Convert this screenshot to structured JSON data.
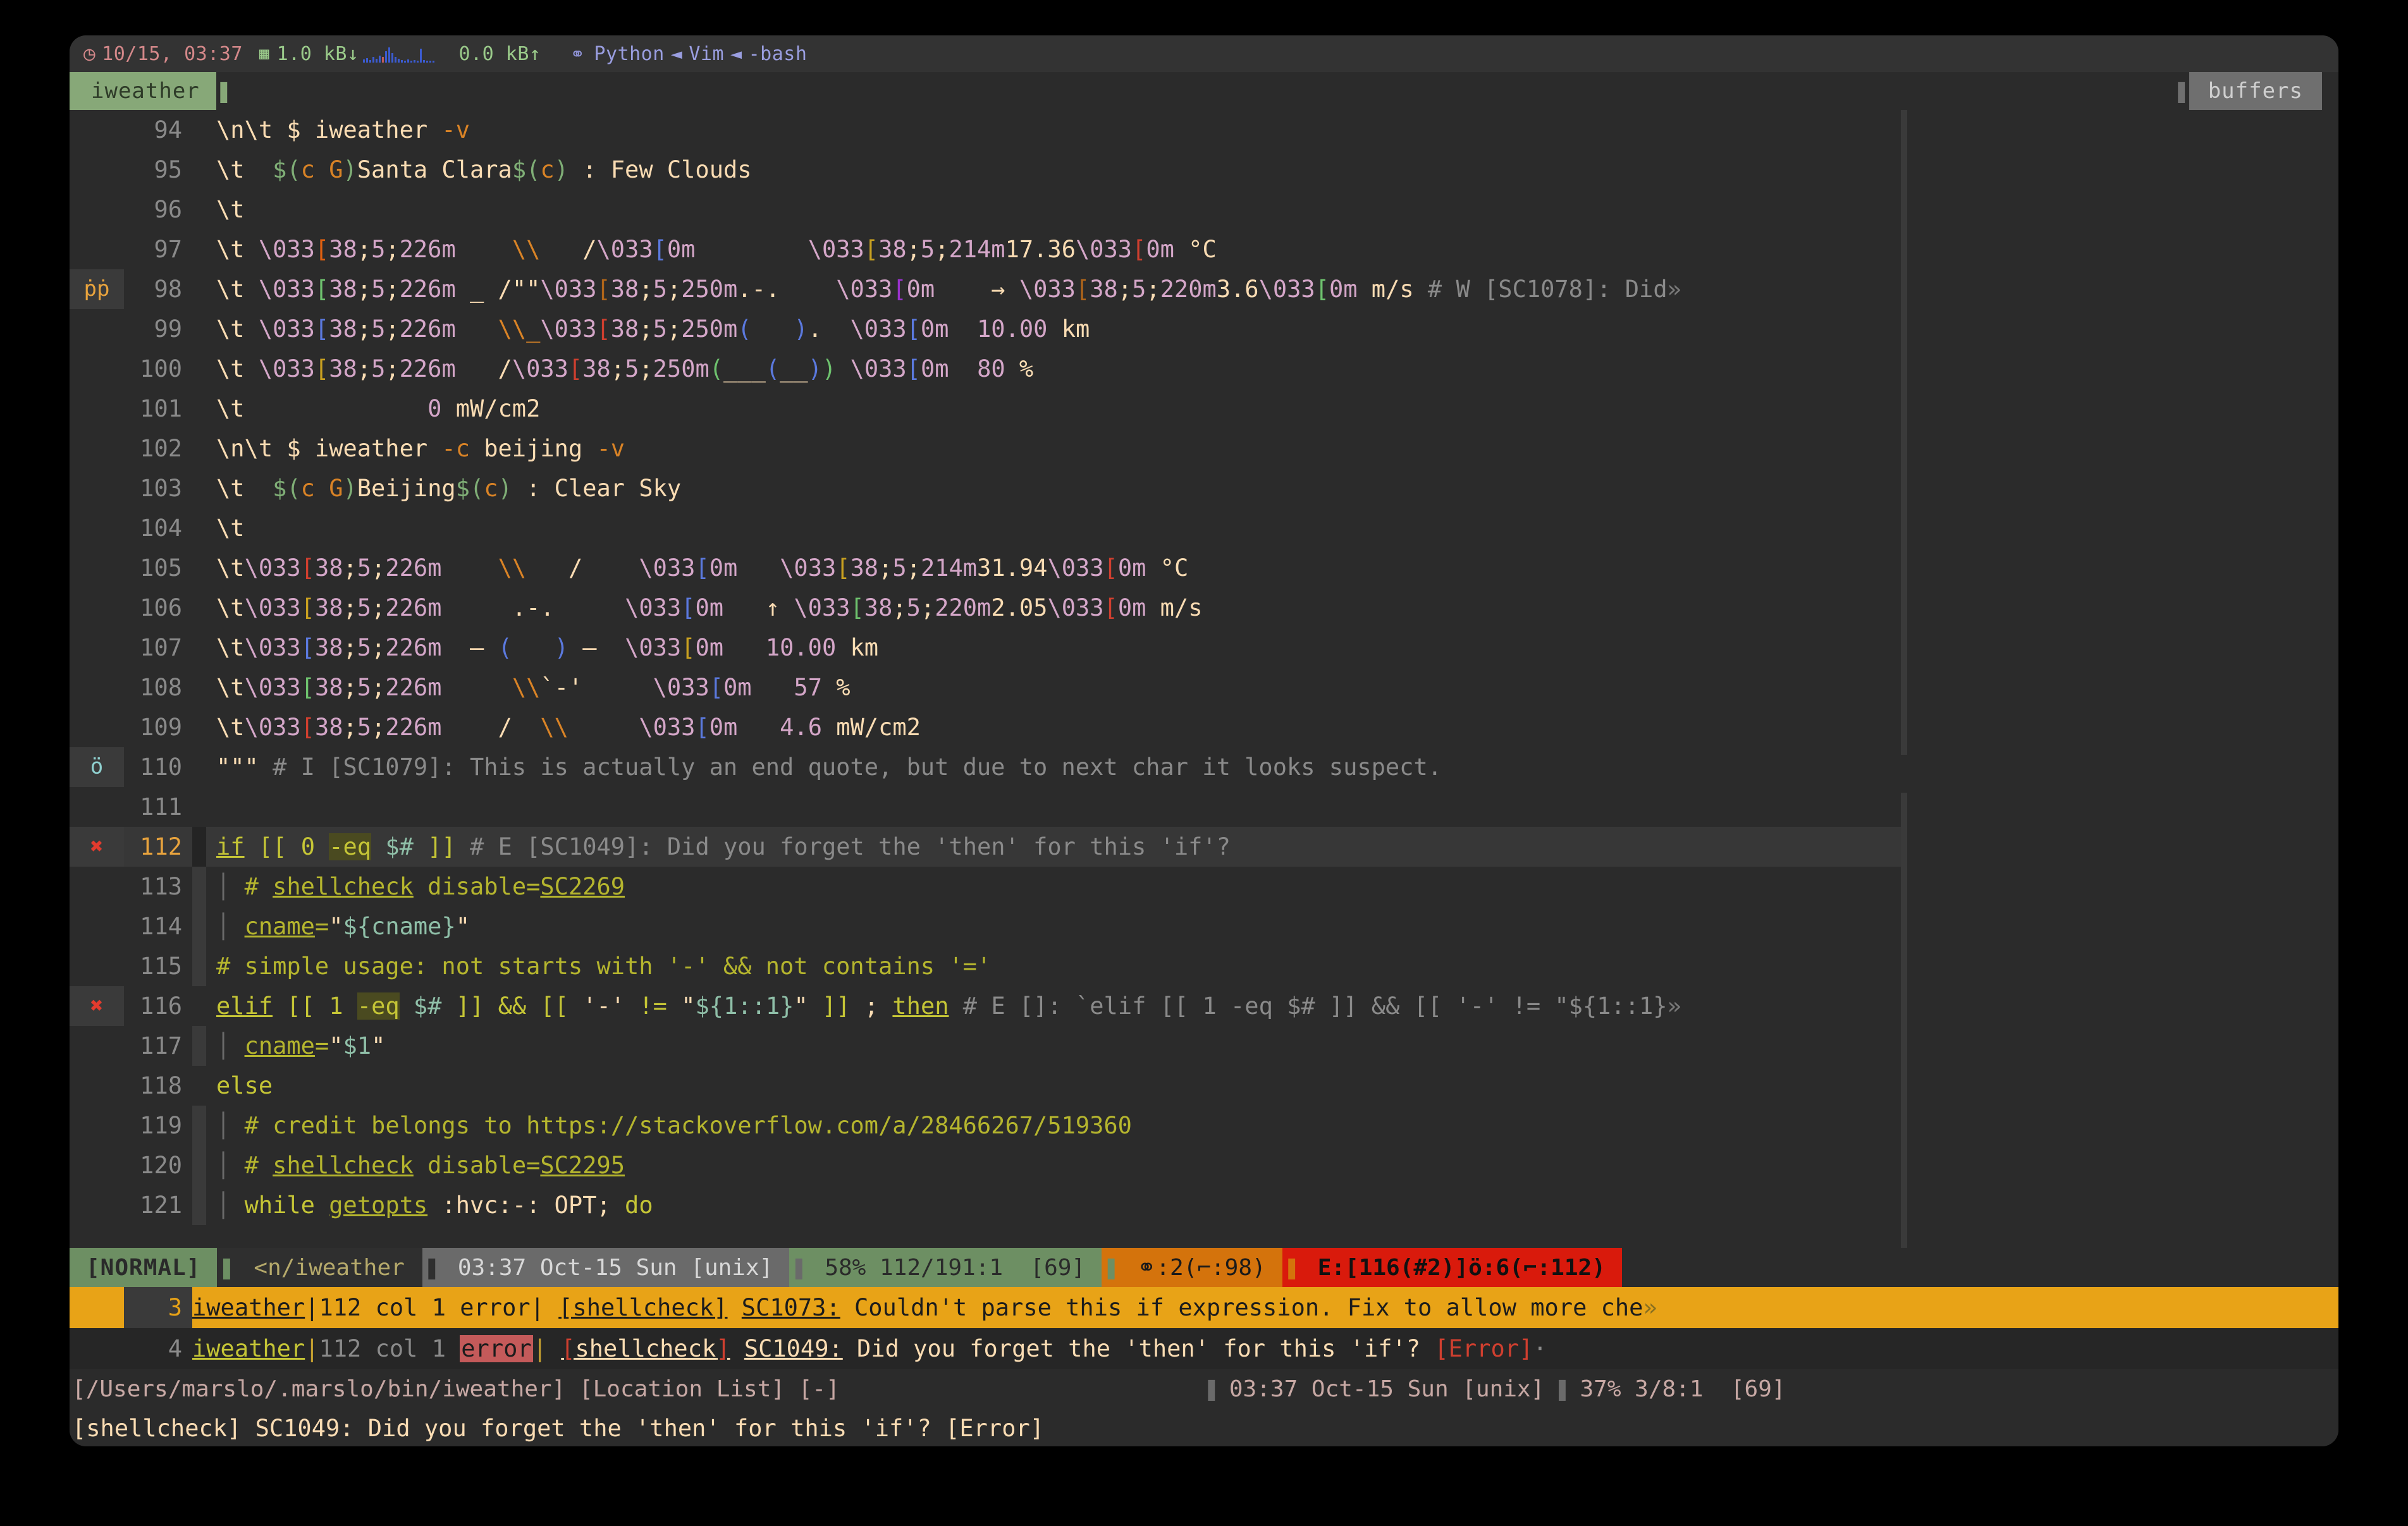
{
  "tmux_status": {
    "clock_icon": "clock-icon",
    "datetime": "10/15, 03:37",
    "net_icon": "network-icon",
    "net_down": "1.0 kB↓",
    "net_up": "0.0 kB↑",
    "proc_icon": "process-icon",
    "proc_python": "Python",
    "sep1": "◄",
    "proc_vim": "Vim",
    "sep2": "◄",
    "proc_bash": "-bash"
  },
  "tabs": {
    "active_window": "iweather",
    "right_window": "buffers"
  },
  "editor": {
    "lines": [
      {
        "num": "94",
        "sign": "",
        "text": "\\n\\t $ iweather -v"
      },
      {
        "num": "95",
        "sign": "",
        "text": "\\t  $(c G)Santa Clara$(c) : Few Clouds"
      },
      {
        "num": "96",
        "sign": "",
        "text": "\\t"
      },
      {
        "num": "97",
        "sign": "",
        "text": "\\t \\033[38;5;226m    \\\\   /\\033[0m        \\033[38;5;214m17.36\\033[0m °C"
      },
      {
        "num": "98",
        "sign": "ṗṗ",
        "text": "\\t \\033[38;5;226m _ /\"\"\\033[38;5;250m.-.    \\033[0m    → \\033[38;5;220m3.6\\033[0m m/s # W [SC1078]: Did»"
      },
      {
        "num": "99",
        "sign": "",
        "text": "\\t \\033[38;5;226m   \\\\_\\033[38;5;250m(   ).  \\033[0m  10.00 km"
      },
      {
        "num": "100",
        "sign": "",
        "text": "\\t \\033[38;5;226m   /\\033[38;5;250m(___(__) \\033[0m  80 %"
      },
      {
        "num": "101",
        "sign": "",
        "text": "\\t             0 mW/cm2"
      },
      {
        "num": "102",
        "sign": "",
        "text": "\\n\\t $ iweather -c beijing -v"
      },
      {
        "num": "103",
        "sign": "",
        "text": "\\t  $(c G)Beijing$(c) : Clear Sky"
      },
      {
        "num": "104",
        "sign": "",
        "text": "\\t"
      },
      {
        "num": "105",
        "sign": "",
        "text": "\\t\\033[38;5;226m    \\\\\\\\   /    \\033[0m   \\033[38;5;214m31.94\\033[0m °C"
      },
      {
        "num": "106",
        "sign": "",
        "text": "\\t\\033[38;5;226m     .-.     \\033[0m   ↑ \\033[38;5;220m2.05\\033[0m m/s"
      },
      {
        "num": "107",
        "sign": "",
        "text": "\\t\\033[38;5;226m  – (   ) –  \\033[0m   10.00 km"
      },
      {
        "num": "108",
        "sign": "",
        "text": "\\t\\033[38;5;226m     \\\\`-'     \\033[0m   57 %"
      },
      {
        "num": "109",
        "sign": "",
        "text": "\\t\\033[38;5;226m    /  \\\\\\\\     \\033[0m   4.6 mW/cm2"
      },
      {
        "num": "110",
        "sign": "ö",
        "text": "\"\"\" # I [SC1079]: This is actually an end quote, but due to next char it looks suspect."
      },
      {
        "num": "111",
        "sign": "",
        "text": ""
      },
      {
        "num": "112",
        "sign": "err",
        "text": "if [[ 0 -eq $# ]] # E [SC1049]: Did you forget the 'then' for this 'if'?"
      },
      {
        "num": "113",
        "sign": "",
        "text": "  # shellcheck disable=SC2269"
      },
      {
        "num": "114",
        "sign": "",
        "text": "  cname=\"${cname}\""
      },
      {
        "num": "115",
        "sign": "",
        "text": "# simple usage: not starts with '-' && not contains '='"
      },
      {
        "num": "116",
        "sign": "err",
        "text": "elif [[ 1 -eq $# ]] && [[ '-' != \"${1::1}\" ]] ; then # E []: `elif [[ 1 -eq $# ]] && [[ '-' != \"${1::1}»"
      },
      {
        "num": "117",
        "sign": "",
        "text": "  cname=\"$1\""
      },
      {
        "num": "118",
        "sign": "",
        "text": "else"
      },
      {
        "num": "119",
        "sign": "",
        "text": "  # credit belongs to https://stackoverflow.com/a/28466267/519360"
      },
      {
        "num": "120",
        "sign": "",
        "text": "  # shellcheck disable=SC2295"
      },
      {
        "num": "121",
        "sign": "",
        "text": "  while getopts :hvc:-: OPT; do"
      }
    ]
  },
  "statusline": {
    "mode": "[NORMAL]",
    "filename": "<n/iweather",
    "time": "03:37 Oct-15 Sun [unix]",
    "position": "58% 112/191:1  [69]",
    "warn_icon": "warning-icon",
    "warn_text": ":2(⌐:98)",
    "err_text": "E:[116(#2)]",
    "err_icon": "error-icon",
    "err_text2": ":6(⌐:112)"
  },
  "location_list": {
    "rows": [
      {
        "num": "3",
        "file": "iweather",
        "loc": "112 col 1 error",
        "linter": "[shellcheck]",
        "code": "SC1073:",
        "message": " Couldn't parse this if expression. Fix to allow more che",
        "wrap": "»",
        "selected": true
      },
      {
        "num": "4",
        "file": "iweather",
        "loc": "112 col 1 ",
        "err_word": "error",
        "linter": "[shellcheck]",
        "code": "SC1049:",
        "message": " Did you forget the 'then' for this 'if'? ",
        "severity": "[Error]",
        "wrap": "·",
        "selected": false
      }
    ]
  },
  "bottom_status": {
    "path": "[/Users/marslo/.marslo/bin/iweather]",
    "list_label": "[Location List]",
    "modified": "[-]",
    "time": "03:37 Oct-15 Sun [unix]",
    "position": "37% 3/8:1  [69]"
  },
  "cmdline": {
    "message": "[shellcheck] SC1049: Did you forget the 'then' for this 'if'? [Error]"
  },
  "colors": {
    "accent_green": "#87a878",
    "warn_orange": "#d4730c",
    "error_red": "#d91a0c",
    "select_amber": "#e8a317",
    "bg": "#2b2b2b"
  }
}
